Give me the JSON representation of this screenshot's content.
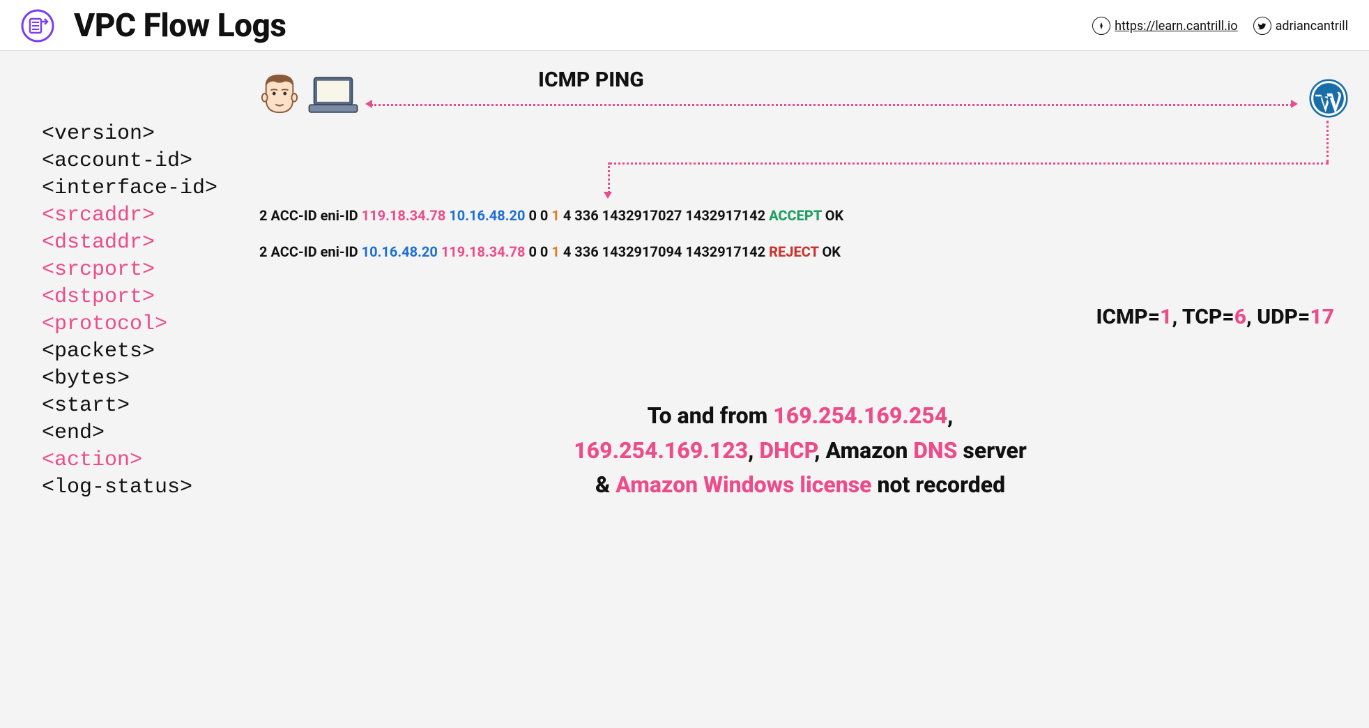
{
  "header": {
    "title": "VPC Flow Logs",
    "site_url": "https://learn.cantrill.io",
    "twitter_handle": "adriancantrill"
  },
  "fields": [
    {
      "text": "<version>",
      "pink": false
    },
    {
      "text": "<account-id>",
      "pink": false
    },
    {
      "text": "<interface-id>",
      "pink": false
    },
    {
      "text": "<srcaddr>",
      "pink": true
    },
    {
      "text": "<dstaddr>",
      "pink": true
    },
    {
      "text": "<srcport>",
      "pink": true
    },
    {
      "text": "<dstport>",
      "pink": true
    },
    {
      "text": "<protocol>",
      "pink": true
    },
    {
      "text": "<packets>",
      "pink": false
    },
    {
      "text": "<bytes>",
      "pink": false
    },
    {
      "text": "<start>",
      "pink": false
    },
    {
      "text": "<end>",
      "pink": false
    },
    {
      "text": "<action>",
      "pink": true
    },
    {
      "text": "<log-status>",
      "pink": false
    }
  ],
  "diagram": {
    "icmp_label": "ICMP PING"
  },
  "log_lines": [
    {
      "parts": [
        {
          "t": "2 ACC-ID eni-ID ",
          "c": ""
        },
        {
          "t": "119.18.34.78 ",
          "c": "pink"
        },
        {
          "t": "10.16.48.20 ",
          "c": "blue"
        },
        {
          "t": "0 0 ",
          "c": ""
        },
        {
          "t": "1 ",
          "c": "orange"
        },
        {
          "t": "4 336 1432917027 1432917142 ",
          "c": ""
        },
        {
          "t": "ACCEPT ",
          "c": "green"
        },
        {
          "t": "OK",
          "c": ""
        }
      ]
    },
    {
      "parts": [
        {
          "t": "2 ACC-ID eni-ID ",
          "c": ""
        },
        {
          "t": "10.16.48.20 ",
          "c": "blue"
        },
        {
          "t": "119.18.34.78 ",
          "c": "pink"
        },
        {
          "t": "0 0 ",
          "c": ""
        },
        {
          "t": "1 ",
          "c": "orange"
        },
        {
          "t": "4 336 1432917094 1432917142 ",
          "c": ""
        },
        {
          "t": "REJECT ",
          "c": "red"
        },
        {
          "t": "OK",
          "c": ""
        }
      ]
    }
  ],
  "protocols": {
    "parts": [
      {
        "t": "ICMP=",
        "c": ""
      },
      {
        "t": "1",
        "c": "pink"
      },
      {
        "t": ", TCP=",
        "c": ""
      },
      {
        "t": "6",
        "c": "pink"
      },
      {
        "t": ", UDP=",
        "c": ""
      },
      {
        "t": "17",
        "c": "pink"
      }
    ]
  },
  "bottom_note": {
    "parts": [
      {
        "t": "To and from ",
        "c": ""
      },
      {
        "t": "169.254.169.254",
        "c": "pink"
      },
      {
        "t": ",",
        "c": ""
      },
      {
        "t": "<br>",
        "c": "br"
      },
      {
        "t": "169.254.169.123",
        "c": "pink"
      },
      {
        "t": ", ",
        "c": ""
      },
      {
        "t": "DHCP",
        "c": "pink"
      },
      {
        "t": ", Amazon ",
        "c": ""
      },
      {
        "t": "DNS",
        "c": "pink"
      },
      {
        "t": " server",
        "c": ""
      },
      {
        "t": "<br>",
        "c": "br"
      },
      {
        "t": "& ",
        "c": ""
      },
      {
        "t": "Amazon Windows license",
        "c": "pink"
      },
      {
        "t": " not recorded",
        "c": ""
      }
    ]
  }
}
